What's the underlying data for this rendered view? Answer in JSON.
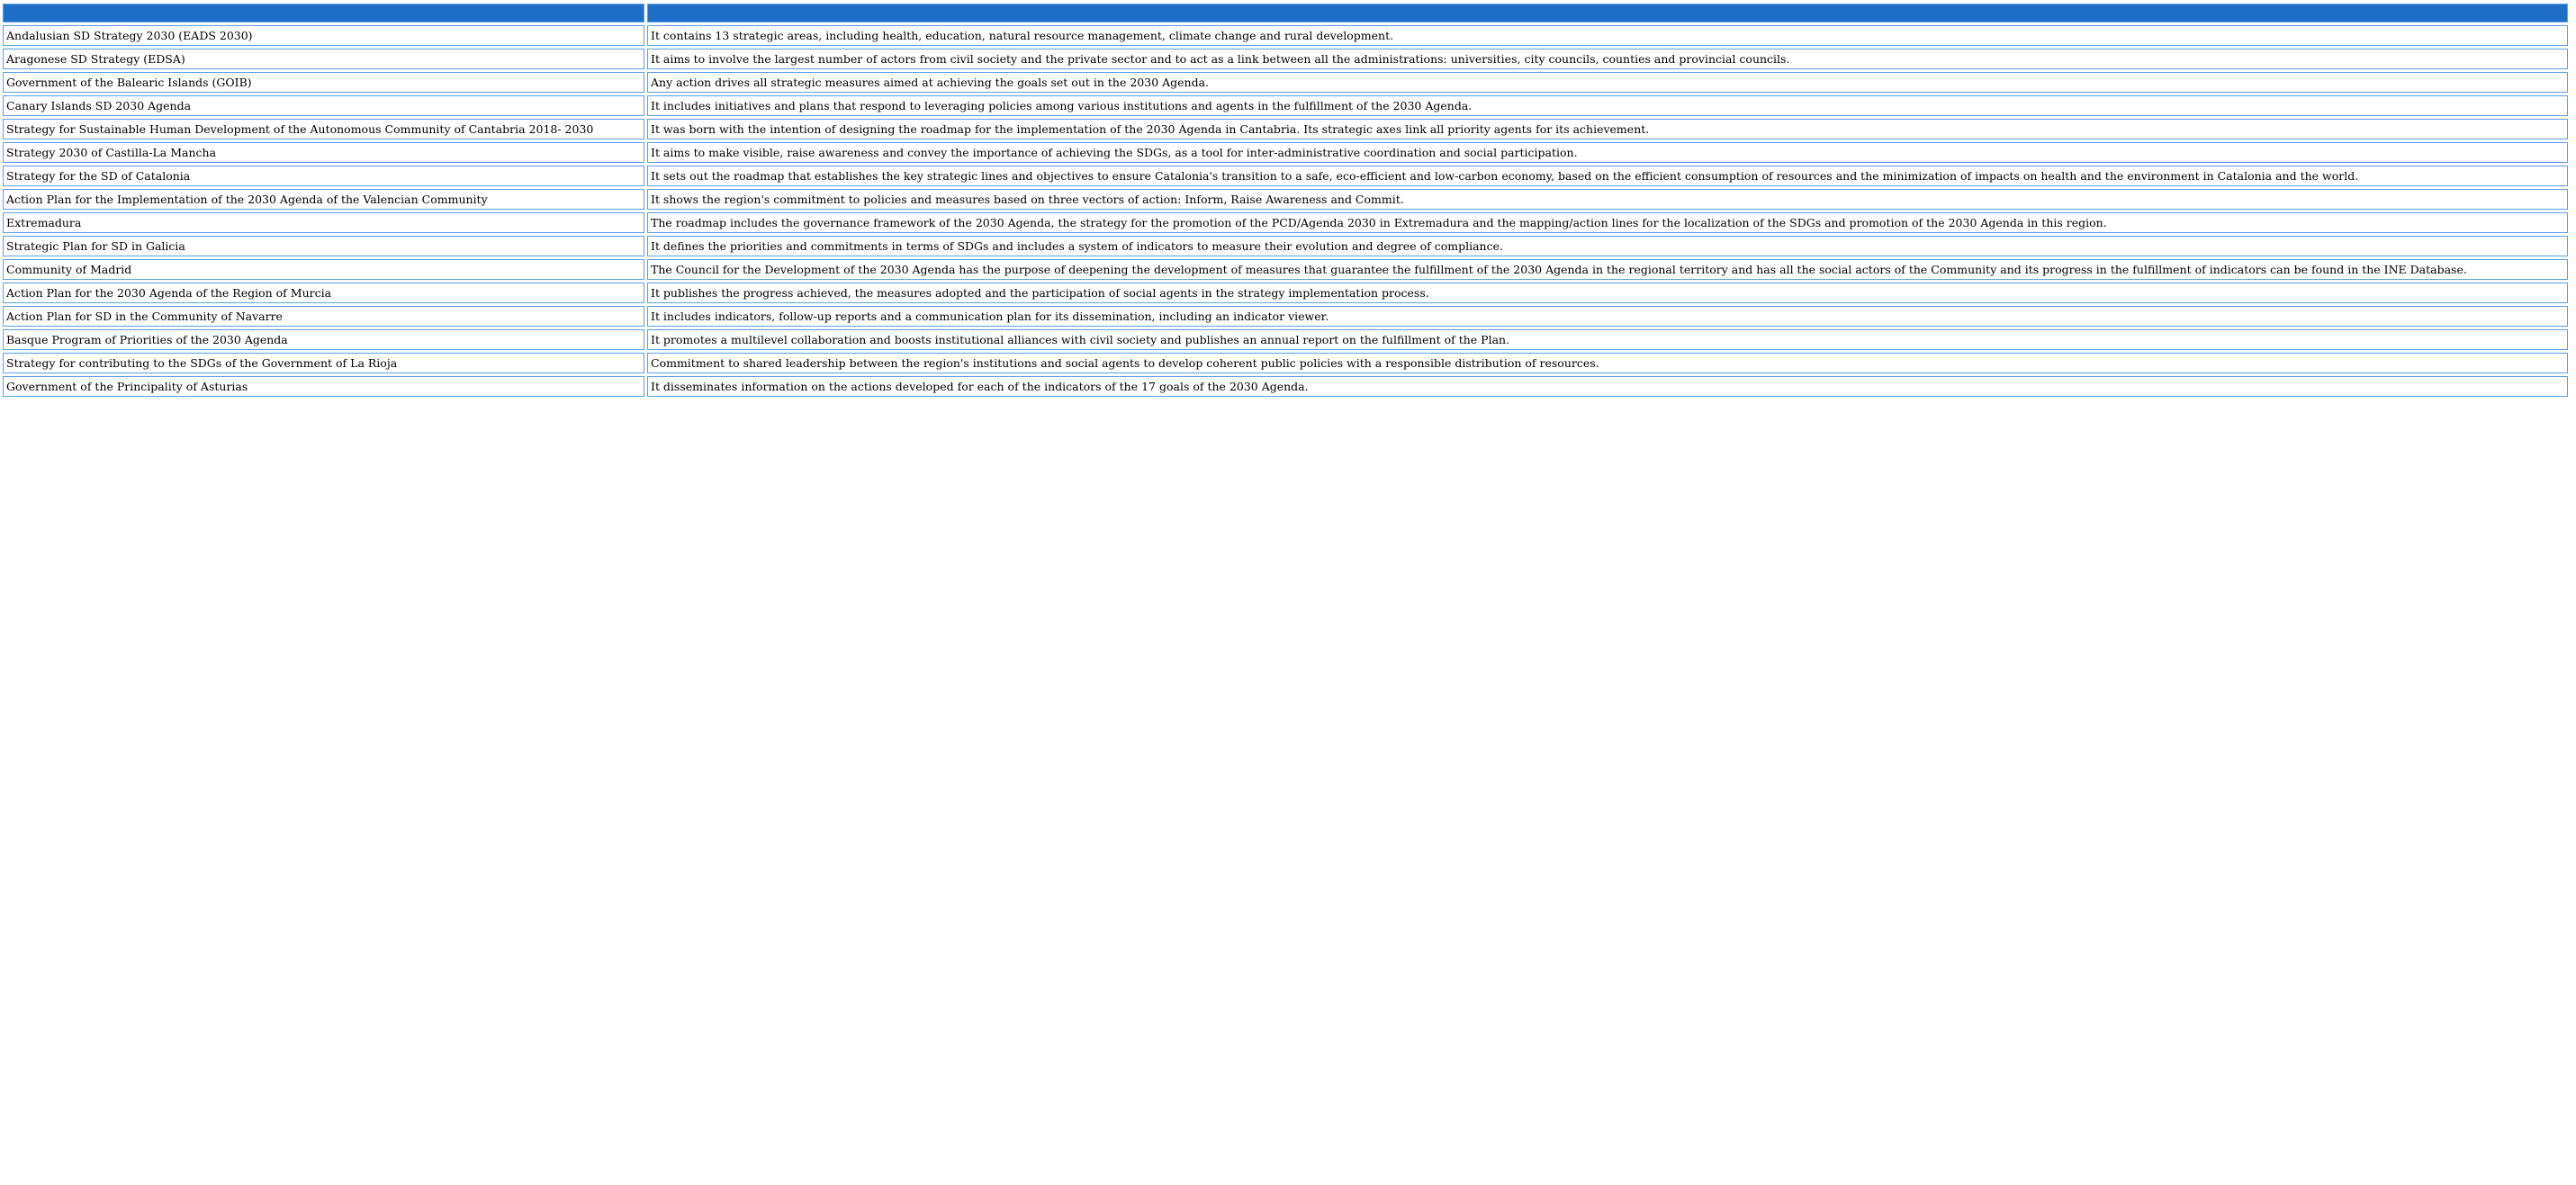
{
  "table": {
    "header": [
      "",
      ""
    ],
    "rows": [
      [
        "Andalusian SD Strategy 2030 (EADS 2030)",
        "It contains 13 strategic areas, including health, education, natural resource management, climate change and rural development."
      ],
      [
        "Aragonese SD Strategy (EDSA)",
        "It aims to involve the largest number of actors from civil society and the private sector and to act as a link between all the administrations: universities, city councils, counties and provincial councils."
      ],
      [
        "Government of the Balearic Islands (GOIB)",
        "Any action drives all strategic measures aimed at achieving the goals set out in the 2030 Agenda."
      ],
      [
        "Canary Islands SD 2030 Agenda",
        "It includes initiatives and plans that respond to leveraging policies among various institutions and agents in the fulfillment of the 2030 Agenda."
      ],
      [
        "Strategy for Sustainable Human Development of the Autonomous Community of Cantabria 2018- 2030",
        "It was born with the intention of designing the roadmap for the implementation of the 2030 Agenda in Cantabria. Its strategic axes link all priority agents for its achievement."
      ],
      [
        "Strategy 2030 of Castilla-La Mancha",
        "It aims to make visible, raise awareness and convey the importance of achieving the SDGs, as a tool for inter-administrative coordination and social participation."
      ],
      [
        "Strategy for the SD of Catalonia",
        "It sets out the roadmap that establishes the key strategic lines and objectives to ensure Catalonia's transition to a safe, eco-efficient and low-carbon economy, based on the efficient consumption of resources and the minimization of impacts on health and the environment in Catalonia and the world."
      ],
      [
        "Action Plan for the Implementation of the 2030 Agenda of the Valencian Community",
        "It shows the region's commitment to policies and measures based on three vectors of action: Inform, Raise Awareness and Commit."
      ],
      [
        "Extremadura",
        "The roadmap includes the governance framework of the 2030 Agenda, the strategy for the promotion of the PCD/Agenda 2030 in Extremadura and the mapping/action lines for the localization of the SDGs and promotion of the 2030 Agenda in this region."
      ],
      [
        "Strategic Plan for SD in Galicia",
        "It defines the priorities and commitments in terms of SDGs and includes a system of indicators to measure their evolution and degree of compliance."
      ],
      [
        "Community of Madrid",
        "The Council for the Development of the 2030 Agenda has the purpose of deepening the development of measures that guarantee the fulfillment of the 2030 Agenda in the regional territory and has all the social actors of the Community and its progress in the fulfillment of indicators can be found in the INE Database."
      ],
      [
        "Action Plan for the 2030 Agenda of the Region of Murcia",
        "It publishes the progress achieved, the measures adopted and the participation of social agents in the strategy implementation process."
      ],
      [
        "Action Plan for SD in the Community of Navarre",
        "It includes indicators, follow-up reports and a communication plan for its dissemination, including an indicator viewer."
      ],
      [
        "Basque Program of Priorities of the 2030 Agenda",
        "It promotes a multilevel collaboration and boosts institutional alliances with civil society and publishes an annual report on the fulfillment of the Plan."
      ],
      [
        "Strategy for contributing to the SDGs of the Government of La Rioja",
        "Commitment to shared leadership between the region's institutions and social agents to develop coherent public policies with a responsible distribution of resources."
      ],
      [
        "Government of the Principality of Asturias",
        "It disseminates information on the actions developed for each of the indicators of the 17 goals of the 2030 Agenda."
      ]
    ]
  }
}
